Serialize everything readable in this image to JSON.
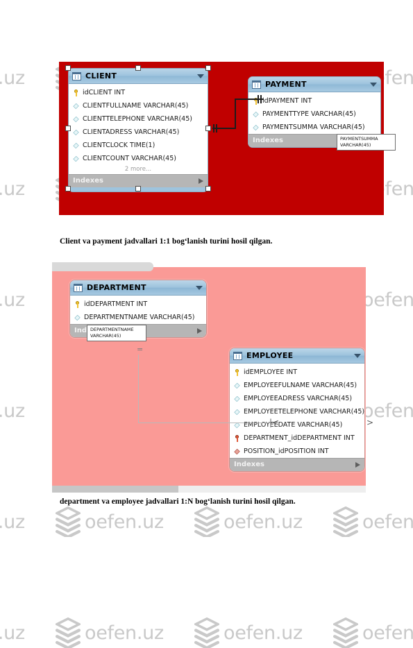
{
  "watermark": {
    "text": "oefen.uz",
    "logo_icon": "stacked-layers-logo",
    "color": "#c9c9c9"
  },
  "figure_one": {
    "canvas_color": "#c00000",
    "relationship_type": "1:1",
    "tables": [
      {
        "name": "CLIENT",
        "title_icon": "table-icon",
        "collapse_icon": "caret-down-icon",
        "columns": [
          {
            "icon": "primary-key-icon",
            "label": "idCLIENT INT"
          },
          {
            "icon": "column-icon",
            "label": "CLIENTFULLNAME VARCHAR(45)"
          },
          {
            "icon": "column-icon",
            "label": "CLIENTTELEPHONE VARCHAR(45)"
          },
          {
            "icon": "column-icon",
            "label": "CLIENTADRESS VARCHAR(45)"
          },
          {
            "icon": "column-icon",
            "label": "CLIENTCLOCK TIME(1)"
          },
          {
            "icon": "column-icon",
            "label": "CLIENTCOUNT VARCHAR(45)"
          }
        ],
        "more_label": "2 more...",
        "indexes_label": "Indexes",
        "indexes_arrow_icon": "play-arrow-icon",
        "selected": true
      },
      {
        "name": "PAYMENT",
        "title_icon": "table-icon",
        "collapse_icon": "caret-down-icon",
        "columns": [
          {
            "icon": "primary-key-icon",
            "label": "idPAYMENT INT"
          },
          {
            "icon": "column-icon",
            "label": "PAYMENTTYPE VARCHAR(45)"
          },
          {
            "icon": "column-icon",
            "label": "PAYMENTSUMMA VARCHAR(45)"
          }
        ],
        "indexes_label": "Indexes",
        "indexes_arrow_icon": "play-arrow-icon",
        "selected": false
      }
    ],
    "tooltip": {
      "line1": "PAYMENTSUMMA",
      "line2": "VARCHAR(45)"
    }
  },
  "figure_two": {
    "canvas_color": "#fa9a96",
    "relationship_type": "1:N",
    "tables": [
      {
        "name": "DEPARTMENT",
        "title_icon": "table-icon",
        "collapse_icon": "caret-down-icon",
        "columns": [
          {
            "icon": "primary-key-icon",
            "label": "idDEPARTMENT INT"
          },
          {
            "icon": "column-icon",
            "label": "DEPARTMENTNAME VARCHAR(45)"
          }
        ],
        "indexes_label": "Indexes",
        "indexes_arrow_icon": "play-arrow-icon"
      },
      {
        "name": "EMPLOYEE",
        "title_icon": "table-icon",
        "collapse_icon": "caret-down-icon",
        "columns": [
          {
            "icon": "primary-key-icon",
            "label": "idEMPLOYEE INT"
          },
          {
            "icon": "column-icon",
            "label": "EMPLOYEEFULNAME VARCHAR(45)"
          },
          {
            "icon": "column-icon",
            "label": "EMPLOYEEADRESS VARCHAR(45)"
          },
          {
            "icon": "column-icon",
            "label": "EMPLOYEETELEPHONE VARCHAR(45)"
          },
          {
            "icon": "column-icon",
            "label": "EMPLOYEEDATE VARCHAR(45)"
          },
          {
            "icon": "foreign-key-icon",
            "label": "DEPARTMENT_idDEPARTMENT INT"
          },
          {
            "icon": "foreign-key-icon",
            "label": "POSITION_idPOSITION INT"
          }
        ],
        "indexes_label": "Indexes",
        "indexes_arrow_icon": "play-arrow-icon"
      }
    ],
    "tooltip": {
      "line1": "DEPARTMENTNAME",
      "line2": "VARCHAR(45)"
    },
    "connector": {
      "identifying_marker": "=",
      "crow_foot_left": "|<",
      "crow_foot_right": ">"
    }
  },
  "captions": {
    "one": "Client va payment jadvallari 1:1  bog‘lanish turini hosil qilgan.",
    "two": "department va employee jadvallari 1:N  bog‘lanish turini hosil qilgan."
  }
}
